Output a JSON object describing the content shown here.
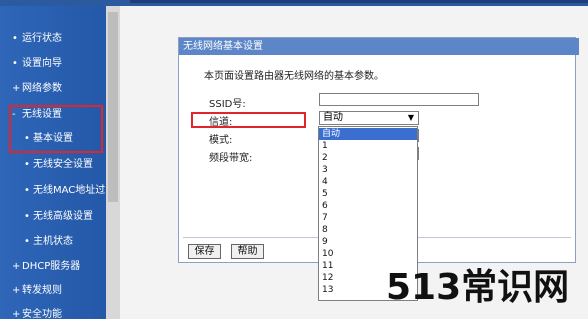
{
  "sidebar": {
    "items": [
      {
        "label": "运行状态",
        "bullet": "•"
      },
      {
        "label": "设置向导",
        "bullet": "•"
      },
      {
        "label": "网络参数",
        "bullet": "+"
      },
      {
        "label": "无线设置",
        "bullet": "-"
      },
      {
        "label": "基本设置",
        "bullet": "•"
      },
      {
        "label": "无线安全设置",
        "bullet": "•"
      },
      {
        "label": "无线MAC地址过滤",
        "bullet": "•"
      },
      {
        "label": "无线高级设置",
        "bullet": "•"
      },
      {
        "label": "主机状态",
        "bullet": "•"
      },
      {
        "label": "DHCP服务器",
        "bullet": "+"
      },
      {
        "label": "转发规则",
        "bullet": "+"
      },
      {
        "label": "安全功能",
        "bullet": "+"
      }
    ]
  },
  "panel": {
    "title": "无线网络基本设置",
    "intro": "本页面设置路由器无线网络的基本参数。",
    "ssid_label": "SSID号:",
    "ssid_value": "",
    "channel_label": "信道:",
    "channel_value": "自动",
    "mode_label": "模式:",
    "bandwidth_label": "频段带宽:",
    "save_label": "保存",
    "help_label": "帮助"
  },
  "dropdown": {
    "options": [
      "自动",
      "1",
      "2",
      "3",
      "4",
      "5",
      "6",
      "7",
      "8",
      "9",
      "10",
      "11",
      "12",
      "13"
    ],
    "selected": "自动"
  },
  "watermark": "513常识网",
  "colors": {
    "sidebar": "#2f66b8",
    "panel_title": "#5d86c8",
    "highlight": "#e0262a",
    "selected_option": "#3a6fd0"
  }
}
